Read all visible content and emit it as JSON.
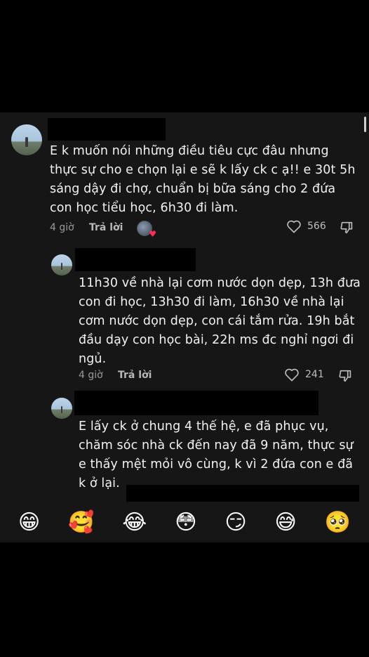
{
  "comments": [
    {
      "text": "E k muốn nói những điều tiêu cực đâu nhưng\nthực sự cho e chọn lại e sẽ k lấy ck c ạ!! e 30t 5h\nsáng dậy đi chợ, chuẩn bị bữa sáng cho 2 đứa\ncon học tiểu học, 6h30 đi làm.",
      "time": "4 giờ",
      "reply": "Trả lời",
      "likes": "566"
    },
    {
      "text": "11h30 về nhà lại cơm nước dọn dẹp, 13h đưa\ncon đi học, 13h30 đi làm, 16h30 về nhà lại\ncơm nước dọn dẹp, con cái tắm rửa. 19h bắt\nđầu dạy con học bài, 22h ms đc nghỉ ngơi đi\nngủ.",
      "time": "4 giờ",
      "reply": "Trả lời",
      "likes": "241"
    },
    {
      "text": "E lấy ck ở chung 4 thế hệ, e đã phục vụ,\nchăm sóc nhà ck đến nay đã 9 năm, thực sự\ne thấy mệt mỏi vô cùng, k vì 2 đứa con e đã\nk ở lại."
    }
  ],
  "emoji_bar": [
    "😁",
    "🥰",
    "😂",
    "😳",
    "😏",
    "😅",
    "🥺"
  ],
  "colors": {
    "background": "#000000",
    "panel": "#161616",
    "heart": "#ff2d55"
  },
  "icons": [
    "heart-outline-icon",
    "dislike-icon",
    "creator-liked-icon"
  ]
}
